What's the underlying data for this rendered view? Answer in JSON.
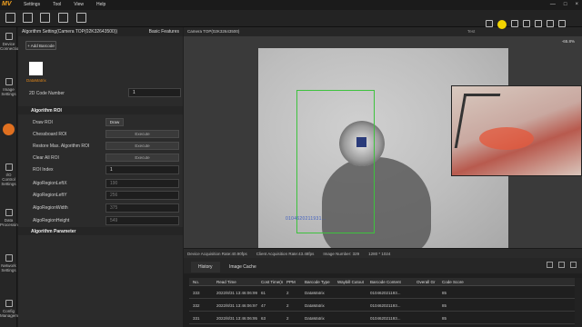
{
  "menubar": {
    "logo": "MV",
    "items": [
      "Settings",
      "Tool",
      "View",
      "Help"
    ],
    "window_controls": [
      "—",
      "□",
      "×"
    ]
  },
  "leftnav": {
    "items": [
      {
        "label": "Device Connection",
        "icon": "device-icon",
        "active": false
      },
      {
        "label": "Image Settings",
        "icon": "image-icon",
        "active": false
      },
      {
        "label": "",
        "icon": "algorithm-icon",
        "active": true
      },
      {
        "label": "I/O Control Settings",
        "icon": "io-control-icon",
        "active": false
      },
      {
        "label": "Data Processing",
        "icon": "data-processing-icon",
        "active": false
      },
      {
        "label": "Network Settings",
        "icon": "network-icon",
        "active": false
      },
      {
        "label": "Config Management",
        "icon": "config-icon",
        "active": false
      }
    ]
  },
  "panel": {
    "title": "Algorithm Setting(Camera TOP(02K32643500))",
    "mode": "Basic Features",
    "add_button": "+ Add Barcode",
    "barcode_type": "DataMatrix",
    "code_number_label": "2D Code Number",
    "code_number_value": "1",
    "roi_section": "Algorithm ROI",
    "draw_roi_label": "Draw ROI",
    "draw_button": "Draw",
    "chessboard_label": "Chessboard ROI",
    "restore_label": "Restore Max. Algorithm ROI",
    "clear_label": "Clear All ROI",
    "execute_label": "Execute",
    "roi_index_label": "ROI Index",
    "roi_index_value": "1",
    "region_left_x_label": "AlgoRegionLeftX",
    "region_left_x_value": "190",
    "region_left_y_label": "AlgoRegionLeftY",
    "region_left_y_value": "256",
    "region_width_label": "AlgoRegionWidth",
    "region_width_value": "375",
    "region_height_label": "AlgoRegionHeight",
    "region_height_value": "549",
    "param_section": "Algorithm Parameter"
  },
  "viewer": {
    "title": "Camera TOP(02K32643500)",
    "subtitle": "Test",
    "zoom": "-65.8%",
    "overlay_text": "0104620211931...",
    "highlight_color": "#f2d400"
  },
  "status": {
    "device_rate": "Device Acquisition Rate:40.90fps",
    "client_rate": "Client Acquisition Rate:43.48fps",
    "image_number": "Image Number: 329",
    "resolution": "1280 * 1024"
  },
  "tabs": {
    "history": "History",
    "image_cache": "Image Cache"
  },
  "table": {
    "headers": [
      "No.",
      "Read Time",
      "Cost Time(ms)",
      "PPM",
      "Barcode Type",
      "Waybill Cutout",
      "Barcode Content",
      "Overall Gr",
      "Code Score"
    ],
    "rows": [
      [
        "333",
        "2022/8/31 13:46:06:997",
        "61",
        "2",
        "DataMatrix",
        "",
        "010462021193...",
        "",
        "85"
      ],
      [
        "332",
        "2022/8/31 13:46:06:974",
        "47",
        "2",
        "DataMatrix",
        "",
        "010462021193...",
        "",
        "85"
      ],
      [
        "331",
        "2022/8/31 13:46:06:952",
        "63",
        "2",
        "DataMatrix",
        "",
        "010462021193...",
        "",
        "85"
      ]
    ]
  }
}
